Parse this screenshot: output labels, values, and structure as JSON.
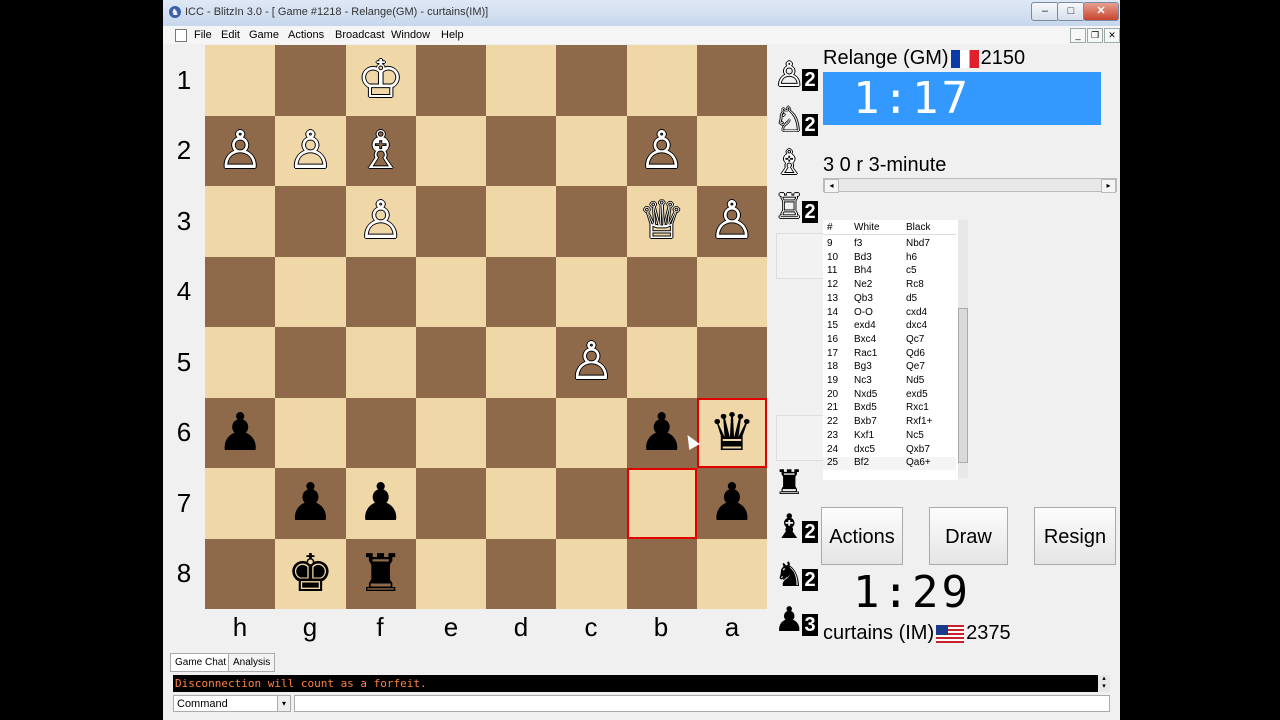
{
  "window": {
    "title": "ICC - BlitzIn 3.0 - [ Game #1218 - Relange(GM) - curtains(IM)]",
    "app_icon": "chess-app-icon",
    "controls": {
      "minimize": "–",
      "maximize": "□",
      "close": "✕"
    }
  },
  "menu": [
    "File",
    "Edit",
    "Game",
    "Actions",
    "Broadcast",
    "Window",
    "Help"
  ],
  "mdi_controls": {
    "minimize": "_",
    "restore": "❐",
    "close": "✕"
  },
  "board": {
    "ranks": [
      "1",
      "2",
      "3",
      "4",
      "5",
      "6",
      "7",
      "8"
    ],
    "files": [
      "h",
      "g",
      "f",
      "e",
      "d",
      "c",
      "b",
      "a"
    ],
    "rows": [
      [
        "",
        "",
        "♔",
        "",
        "",
        "",
        "",
        ""
      ],
      [
        "♙",
        "♙",
        "♗",
        "",
        "",
        "",
        "♙",
        ""
      ],
      [
        "",
        "",
        "♙",
        "",
        "",
        "",
        "♕",
        "♙"
      ],
      [
        "",
        "",
        "",
        "",
        "",
        "",
        "",
        ""
      ],
      [
        "",
        "",
        "",
        "",
        "",
        "♙",
        "",
        ""
      ],
      [
        "♟",
        "",
        "",
        "",
        "",
        "",
        "♟",
        "♛"
      ],
      [
        "",
        "♟",
        "♟",
        "",
        "",
        "",
        "",
        "♟"
      ],
      [
        "",
        "♚",
        "♜",
        "",
        "",
        "",
        "",
        ""
      ]
    ],
    "colors": [
      [
        "",
        "",
        "w",
        "",
        "",
        "",
        "",
        ""
      ],
      [
        "w",
        "w",
        "w",
        "",
        "",
        "",
        "w",
        ""
      ],
      [
        "",
        "",
        "w",
        "",
        "",
        "",
        "w",
        "w"
      ],
      [
        "",
        "",
        "",
        "",
        "",
        "",
        "",
        ""
      ],
      [
        "",
        "",
        "",
        "",
        "",
        "w",
        "",
        ""
      ],
      [
        "b",
        "",
        "",
        "",
        "",
        "",
        "b",
        "b"
      ],
      [
        "",
        "b",
        "b",
        "",
        "",
        "",
        "",
        "b"
      ],
      [
        "",
        "b",
        "b",
        "",
        "",
        "",
        "",
        ""
      ]
    ],
    "last_move_from": "a7-file-b",
    "last_move_to": "a6"
  },
  "captured": {
    "top": [
      {
        "glyph": "♙",
        "count": "2"
      },
      {
        "glyph": "♘",
        "count": "2"
      },
      {
        "glyph": "♗",
        "count": ""
      },
      {
        "glyph": "♖",
        "count": "2"
      }
    ],
    "bottom": [
      {
        "glyph": "♜",
        "count": ""
      },
      {
        "glyph": "♝",
        "count": "2"
      },
      {
        "glyph": "♞",
        "count": "2"
      },
      {
        "glyph": "♟",
        "count": "3"
      }
    ]
  },
  "top_player": {
    "name": "Relange (GM)",
    "flag": "flag-france-icon",
    "rating": "2150",
    "clock": "1:17"
  },
  "bottom_player": {
    "name": "curtains (IM)",
    "flag": "flag-usa-icon",
    "rating": "2375",
    "clock": "1:29"
  },
  "game_type": "3 0 r 3-minute",
  "moves": {
    "headers": [
      "#",
      "White",
      "Black"
    ],
    "rows": [
      [
        "9",
        "f3",
        "Nbd7"
      ],
      [
        "10",
        "Bd3",
        "h6"
      ],
      [
        "11",
        "Bh4",
        "c5"
      ],
      [
        "12",
        "Ne2",
        "Rc8"
      ],
      [
        "13",
        "Qb3",
        "d5"
      ],
      [
        "14",
        "O-O",
        "cxd4"
      ],
      [
        "15",
        "exd4",
        "dxc4"
      ],
      [
        "16",
        "Bxc4",
        "Qc7"
      ],
      [
        "17",
        "Rac1",
        "Qd6"
      ],
      [
        "18",
        "Bg3",
        "Qe7"
      ],
      [
        "19",
        "Nc3",
        "Nd5"
      ],
      [
        "20",
        "Nxd5",
        "exd5"
      ],
      [
        "21",
        "Bxd5",
        "Rxc1"
      ],
      [
        "22",
        "Bxb7",
        "Rxf1+"
      ],
      [
        "23",
        "Kxf1",
        "Nc5"
      ],
      [
        "24",
        "dxc5",
        "Qxb7"
      ],
      [
        "25",
        "Bf2",
        "Qa6+"
      ]
    ]
  },
  "buttons": {
    "actions": "Actions",
    "draw": "Draw",
    "resign": "Resign"
  },
  "tabs": [
    "Game Chat",
    "Analysis"
  ],
  "chat": {
    "message": "Disconnection will count as a forfeit."
  },
  "command": {
    "selected": "Command",
    "input": ""
  }
}
